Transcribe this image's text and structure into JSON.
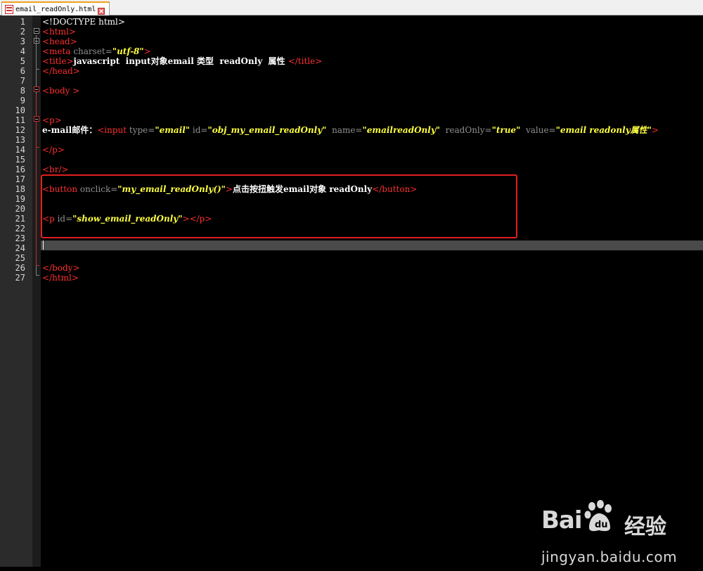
{
  "tab": {
    "filename": "email_readOnly.html",
    "file_icon": "html-file-icon",
    "close_icon": "close-icon"
  },
  "colors": {
    "tag": "#ff3030",
    "attribute": "#909090",
    "string": "#ffff40",
    "text": "#ffffff",
    "background": "#000000",
    "highlight_box": "#e02020",
    "current_line": "#4a4a4a"
  },
  "line_numbers": [
    "1",
    "2",
    "3",
    "4",
    "5",
    "6",
    "7",
    "8",
    "9",
    "10",
    "11",
    "12",
    "13",
    "14",
    "15",
    "16",
    "17",
    "18",
    "19",
    "20",
    "21",
    "22",
    "23",
    "24",
    "25",
    "26",
    "27"
  ],
  "code": {
    "l1": {
      "text": "<!DOCTYPE html>"
    },
    "l2": {
      "tag": "<html>"
    },
    "l3": {
      "tag": "<head>"
    },
    "l4": {
      "tag_open": "<meta",
      "attr": " charset=",
      "val": "\"utf-8\"",
      "tag_close": ">"
    },
    "l5": {
      "tag_open": "<title>",
      "text": "javascript  input对象email 类型  readOnly  属性 ",
      "tag_close": "</title>"
    },
    "l6": {
      "tag": "</head>"
    },
    "l8": {
      "tag": "<body >"
    },
    "l11": {
      "tag": "<p>"
    },
    "l12": {
      "text": "e-mail邮件：",
      "t1": "<input",
      "a1": " type=",
      "v1": "\"email\"",
      "a2": " id=",
      "v2": "\"obj_my_email_readOnly\"",
      "a3": "  name=",
      "v3": "\"emailreadOnly\"",
      "a4": "  readOnly=",
      "v4": "\"true\"",
      "a5": "  value=",
      "v5": "\"email readonly属性\"",
      "t2": ">"
    },
    "l14": {
      "tag": "</p>"
    },
    "l16": {
      "tag": "<br/>"
    },
    "l18": {
      "t1": "<button",
      "a1": " onclick=",
      "v1": "\"my_email_readOnly()\"",
      "t2": ">",
      "text": "点击按扭触发email对象 readOnly",
      "t3": "</button>"
    },
    "l21": {
      "t1": "<p",
      "a1": " id=",
      "v1": "\"show_email_readOnly\"",
      "t2": "></p>"
    },
    "l26": {
      "tag": "</body>"
    },
    "l27": {
      "tag": "</html>"
    }
  },
  "watermark": {
    "brand": "Bai",
    "brand2": "du",
    "product": "经验",
    "url": "jingyan.baidu.com"
  }
}
